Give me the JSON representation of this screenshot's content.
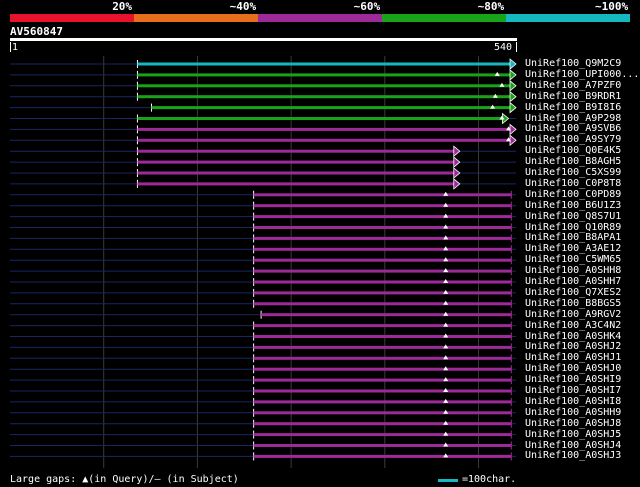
{
  "scale_labels": [
    {
      "text": "20%",
      "x_pct": 20
    },
    {
      "text": "~40%",
      "x_pct": 40
    },
    {
      "text": "~60%",
      "x_pct": 60
    },
    {
      "text": "~80%",
      "x_pct": 80
    },
    {
      "text": "~100%",
      "x_pct": 100
    }
  ],
  "identity_colors": [
    "#e8132a",
    "#e66f1c",
    "#9e2a99",
    "#18a418",
    "#16b8bf"
  ],
  "query": {
    "id": "AV560847",
    "start": "1",
    "end": "540",
    "length": 540
  },
  "legend": {
    "gaps_text": "Large gaps: ▲(in Query)/— (in Subject)",
    "scale_text": "=100char.",
    "scale_color": "#16b8bf"
  },
  "chart_data": {
    "type": "alignment",
    "query_length": 540,
    "hits": [
      {
        "name": "UniRef100_Q9M2C9",
        "start": 136,
        "end": 540,
        "identity_band": 5,
        "query_gaps": [],
        "arrow": true
      },
      {
        "name": "UniRef100_UPI000...",
        "start": 136,
        "end": 540,
        "identity_band": 4,
        "query_gaps": [
          520
        ],
        "arrow": true
      },
      {
        "name": "UniRef100_A7PZF0",
        "start": 136,
        "end": 540,
        "identity_band": 4,
        "query_gaps": [
          525
        ],
        "arrow": true
      },
      {
        "name": "UniRef100_B9RDR1",
        "start": 136,
        "end": 540,
        "identity_band": 4,
        "query_gaps": [
          518
        ],
        "arrow": true
      },
      {
        "name": "UniRef100_B9I8I6",
        "start": 151,
        "end": 540,
        "identity_band": 4,
        "query_gaps": [
          515
        ],
        "arrow": true
      },
      {
        "name": "UniRef100_A9P298",
        "start": 136,
        "end": 532,
        "identity_band": 4,
        "query_gaps": [
          525
        ],
        "arrow": true
      },
      {
        "name": "UniRef100_A9SVB6",
        "start": 136,
        "end": 540,
        "identity_band": 3,
        "query_gaps": [
          532
        ],
        "arrow": true
      },
      {
        "name": "UniRef100_A9SY79",
        "start": 136,
        "end": 540,
        "identity_band": 3,
        "query_gaps": [
          532
        ],
        "arrow": true
      },
      {
        "name": "UniRef100_Q0E4K5",
        "start": 136,
        "end": 480,
        "identity_band": 3,
        "query_gaps": [],
        "arrow": true
      },
      {
        "name": "UniRef100_B8AGH5",
        "start": 136,
        "end": 480,
        "identity_band": 3,
        "query_gaps": [],
        "arrow": true
      },
      {
        "name": "UniRef100_C5XS99",
        "start": 136,
        "end": 480,
        "identity_band": 3,
        "query_gaps": [],
        "arrow": true
      },
      {
        "name": "UniRef100_C0P8T8",
        "start": 136,
        "end": 480,
        "identity_band": 3,
        "query_gaps": [],
        "arrow": true
      },
      {
        "name": "UniRef100_C0PD89",
        "start": 260,
        "end": 535,
        "identity_band": 3,
        "query_gaps": [
          465
        ],
        "arrow": false
      },
      {
        "name": "UniRef100_B6U1Z3",
        "start": 260,
        "end": 535,
        "identity_band": 3,
        "query_gaps": [
          465
        ],
        "arrow": false
      },
      {
        "name": "UniRef100_Q8S7U1",
        "start": 260,
        "end": 535,
        "identity_band": 3,
        "query_gaps": [
          465
        ],
        "arrow": false
      },
      {
        "name": "UniRef100_Q10R89",
        "start": 260,
        "end": 535,
        "identity_band": 3,
        "query_gaps": [
          465
        ],
        "arrow": false
      },
      {
        "name": "UniRef100_B8APA1",
        "start": 260,
        "end": 535,
        "identity_band": 3,
        "query_gaps": [
          465
        ],
        "arrow": false
      },
      {
        "name": "UniRef100_A3AE12",
        "start": 260,
        "end": 535,
        "identity_band": 3,
        "query_gaps": [
          465
        ],
        "arrow": false
      },
      {
        "name": "UniRef100_C5WM65",
        "start": 260,
        "end": 535,
        "identity_band": 3,
        "query_gaps": [
          465
        ],
        "arrow": false
      },
      {
        "name": "UniRef100_A0SHH8",
        "start": 260,
        "end": 535,
        "identity_band": 3,
        "query_gaps": [
          465
        ],
        "arrow": false
      },
      {
        "name": "UniRef100_A0SHH7",
        "start": 260,
        "end": 535,
        "identity_band": 3,
        "query_gaps": [
          465
        ],
        "arrow": false
      },
      {
        "name": "UniRef100_Q7XES2",
        "start": 260,
        "end": 535,
        "identity_band": 3,
        "query_gaps": [
          465
        ],
        "arrow": false
      },
      {
        "name": "UniRef100_B8BGS5",
        "start": 260,
        "end": 535,
        "identity_band": 3,
        "query_gaps": [
          465
        ],
        "arrow": false
      },
      {
        "name": "UniRef100_A9RGV2",
        "start": 268,
        "end": 535,
        "identity_band": 3,
        "query_gaps": [
          465
        ],
        "arrow": false
      },
      {
        "name": "UniRef100_A3C4N2",
        "start": 260,
        "end": 535,
        "identity_band": 3,
        "query_gaps": [
          465
        ],
        "arrow": false
      },
      {
        "name": "UniRef100_A0SHK4",
        "start": 260,
        "end": 535,
        "identity_band": 3,
        "query_gaps": [
          465
        ],
        "arrow": false
      },
      {
        "name": "UniRef100_A0SHJ2",
        "start": 260,
        "end": 535,
        "identity_band": 3,
        "query_gaps": [
          465
        ],
        "arrow": false
      },
      {
        "name": "UniRef100_A0SHJ1",
        "start": 260,
        "end": 535,
        "identity_band": 3,
        "query_gaps": [
          465
        ],
        "arrow": false
      },
      {
        "name": "UniRef100_A0SHJ0",
        "start": 260,
        "end": 535,
        "identity_band": 3,
        "query_gaps": [
          465
        ],
        "arrow": false
      },
      {
        "name": "UniRef100_A0SHI9",
        "start": 260,
        "end": 535,
        "identity_band": 3,
        "query_gaps": [
          465
        ],
        "arrow": false
      },
      {
        "name": "UniRef100_A0SHI7",
        "start": 260,
        "end": 535,
        "identity_band": 3,
        "query_gaps": [
          465
        ],
        "arrow": false
      },
      {
        "name": "UniRef100_A0SHI8",
        "start": 260,
        "end": 535,
        "identity_band": 3,
        "query_gaps": [
          465
        ],
        "arrow": false
      },
      {
        "name": "UniRef100_A0SHH9",
        "start": 260,
        "end": 535,
        "identity_band": 3,
        "query_gaps": [
          465
        ],
        "arrow": false
      },
      {
        "name": "UniRef100_A0SHJ8",
        "start": 260,
        "end": 535,
        "identity_band": 3,
        "query_gaps": [
          465
        ],
        "arrow": false
      },
      {
        "name": "UniRef100_A0SHJ5",
        "start": 260,
        "end": 535,
        "identity_band": 3,
        "query_gaps": [
          465
        ],
        "arrow": false
      },
      {
        "name": "UniRef100_A0SHJ4",
        "start": 260,
        "end": 535,
        "identity_band": 3,
        "query_gaps": [
          465
        ],
        "arrow": false
      },
      {
        "name": "UniRef100_A0SHJ3",
        "start": 260,
        "end": 535,
        "identity_band": 3,
        "query_gaps": [
          465
        ],
        "arrow": false
      }
    ]
  }
}
